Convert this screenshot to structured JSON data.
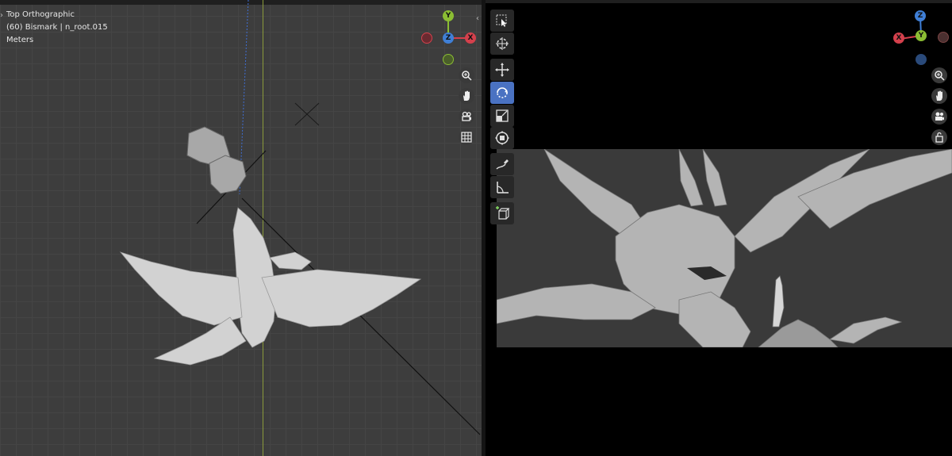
{
  "left_viewport": {
    "view_name": "Top Orthographic",
    "object_info": "(60) Bismark | n_root.015",
    "units": "Meters",
    "gizmo": {
      "x_label": "X",
      "y_label": "Y",
      "z_label": "Z"
    },
    "nav_icons": [
      "zoom-icon",
      "hand-icon",
      "camera-icon",
      "grid-icon"
    ]
  },
  "right_viewport": {
    "gizmo": {
      "x_label": "X",
      "y_label": "Y",
      "z_label": "Z"
    },
    "nav_icons": [
      "zoom-icon",
      "hand-icon",
      "camera-icon",
      "lock-icon"
    ]
  },
  "toolbar": {
    "tools": [
      "select-box",
      "cursor",
      "move",
      "rotate",
      "scale",
      "transform",
      "annotate",
      "measure",
      "add-cube"
    ],
    "active_tool": "rotate"
  },
  "colors": {
    "x_axis": "#d4404c",
    "y_axis": "#8bbd33",
    "z_axis": "#3f7fd6",
    "active_tool": "#4a72c2"
  }
}
